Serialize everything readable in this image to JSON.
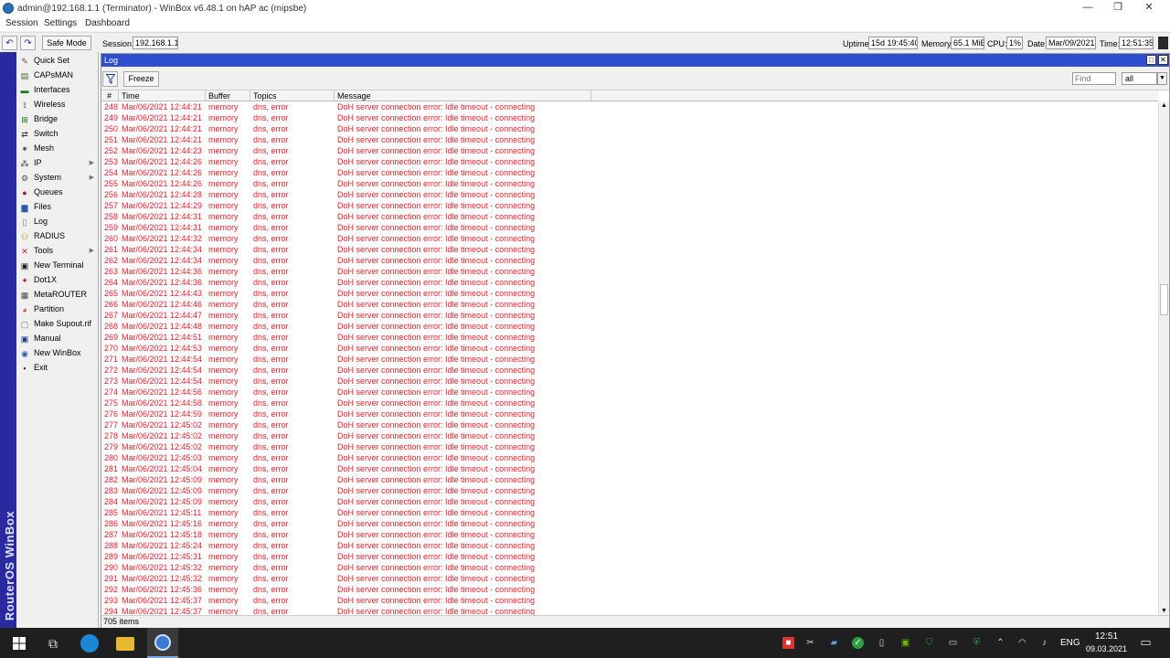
{
  "window": {
    "title": "admin@192.168.1.1 (Terminator) - WinBox v6.48.1 on hAP ac (mipsbe)",
    "minimize": "—",
    "maximize": "❐",
    "close": "✕"
  },
  "menu": {
    "session": "Session",
    "settings": "Settings",
    "dashboard": "Dashboard"
  },
  "toolbar": {
    "undo_icon": "undo-icon",
    "redo_icon": "redo-icon",
    "safe_mode": "Safe Mode",
    "session_label": "Session:",
    "session_value": "192.168.1.1",
    "uptime_label": "Uptime:",
    "uptime_value": "15d 19:45:40",
    "memory_label": "Memory:",
    "memory_value": "65.1 MiB",
    "cpu_label": "CPU:",
    "cpu_value": "1%",
    "date_label": "Date:",
    "date_value": "Mar/09/2021",
    "time_label": "Time:",
    "time_value": "12:51:35"
  },
  "brand_vertical": "RouterOS WinBox",
  "sidebar": {
    "items": [
      {
        "label": "Quick Set",
        "icon": "quick-set-icon",
        "glyph": "✎",
        "color": "#7a4a2a",
        "arrow": false
      },
      {
        "label": "CAPsMAN",
        "icon": "capsman-icon",
        "glyph": "▤",
        "color": "#3a6a3a",
        "arrow": false
      },
      {
        "label": "Interfaces",
        "icon": "interfaces-icon",
        "glyph": "▬",
        "color": "#1a7a1a",
        "arrow": false
      },
      {
        "label": "Wireless",
        "icon": "wireless-icon",
        "glyph": "⟟",
        "color": "#222",
        "arrow": false
      },
      {
        "label": "Bridge",
        "icon": "bridge-icon",
        "glyph": "⊞",
        "color": "#1a6a1a",
        "arrow": false
      },
      {
        "label": "Switch",
        "icon": "switch-icon",
        "glyph": "⇄",
        "color": "#333",
        "arrow": false
      },
      {
        "label": "Mesh",
        "icon": "mesh-icon",
        "glyph": "✶",
        "color": "#333",
        "arrow": false
      },
      {
        "label": "IP",
        "icon": "ip-icon",
        "glyph": "⁂",
        "color": "#444",
        "arrow": true
      },
      {
        "label": "System",
        "icon": "system-icon",
        "glyph": "⚙",
        "color": "#555",
        "arrow": true
      },
      {
        "label": "Queues",
        "icon": "queues-icon",
        "glyph": "●",
        "color": "#8a2a2a",
        "arrow": false
      },
      {
        "label": "Files",
        "icon": "files-icon",
        "glyph": "▆",
        "color": "#2a5aa8",
        "arrow": false
      },
      {
        "label": "Log",
        "icon": "log-icon",
        "glyph": "▯",
        "color": "#777",
        "arrow": false
      },
      {
        "label": "RADIUS",
        "icon": "radius-icon",
        "glyph": "⚇",
        "color": "#b58a00",
        "arrow": false
      },
      {
        "label": "Tools",
        "icon": "tools-icon",
        "glyph": "✕",
        "color": "#b02a2a",
        "arrow": true
      },
      {
        "label": "New Terminal",
        "icon": "terminal-icon",
        "glyph": "▣",
        "color": "#222",
        "arrow": false
      },
      {
        "label": "Dot1X",
        "icon": "dot1x-icon",
        "glyph": "✦",
        "color": "#b02a2a",
        "arrow": false
      },
      {
        "label": "MetaROUTER",
        "icon": "metarouter-icon",
        "glyph": "▦",
        "color": "#444",
        "arrow": false
      },
      {
        "label": "Partition",
        "icon": "partition-icon",
        "glyph": "◕",
        "color": "#c04a1a",
        "arrow": false
      },
      {
        "label": "Make Supout.rif",
        "icon": "supout-icon",
        "glyph": "▢",
        "color": "#777",
        "arrow": false
      },
      {
        "label": "Manual",
        "icon": "manual-icon",
        "glyph": "▣",
        "color": "#1a3a8a",
        "arrow": false
      },
      {
        "label": "New WinBox",
        "icon": "winbox-icon",
        "glyph": "◉",
        "color": "#2a5aa8",
        "arrow": false
      },
      {
        "label": "Exit",
        "icon": "exit-icon",
        "glyph": "▪",
        "color": "#6a2a1a",
        "arrow": false
      }
    ]
  },
  "log": {
    "title": "Log",
    "restore_icon": "□",
    "close_icon": "✕",
    "freeze": "Freeze",
    "find_placeholder": "Find",
    "filter_value": "all",
    "columns": [
      "#",
      "Time",
      "Buffer",
      "Topics",
      "Message"
    ],
    "rows": [
      [
        "248",
        "Mar/06/2021 12:44:21",
        "memory",
        "dns, error",
        "DoH server connection error: Idle timeout - connecting"
      ],
      [
        "249",
        "Mar/06/2021 12:44:21",
        "memory",
        "dns, error",
        "DoH server connection error: Idle timeout - connecting"
      ],
      [
        "250",
        "Mar/06/2021 12:44:21",
        "memory",
        "dns, error",
        "DoH server connection error: Idle timeout - connecting"
      ],
      [
        "251",
        "Mar/06/2021 12:44:21",
        "memory",
        "dns, error",
        "DoH server connection error: Idle timeout - connecting"
      ],
      [
        "252",
        "Mar/06/2021 12:44:23",
        "memory",
        "dns, error",
        "DoH server connection error: Idle timeout - connecting"
      ],
      [
        "253",
        "Mar/06/2021 12:44:26",
        "memory",
        "dns, error",
        "DoH server connection error: Idle timeout - connecting"
      ],
      [
        "254",
        "Mar/06/2021 12:44:26",
        "memory",
        "dns, error",
        "DoH server connection error: Idle timeout - connecting"
      ],
      [
        "255",
        "Mar/06/2021 12:44:26",
        "memory",
        "dns, error",
        "DoH server connection error: Idle timeout - connecting"
      ],
      [
        "256",
        "Mar/06/2021 12:44:28",
        "memory",
        "dns, error",
        "DoH server connection error: Idle timeout - connecting"
      ],
      [
        "257",
        "Mar/06/2021 12:44:29",
        "memory",
        "dns, error",
        "DoH server connection error: Idle timeout - connecting"
      ],
      [
        "258",
        "Mar/06/2021 12:44:31",
        "memory",
        "dns, error",
        "DoH server connection error: Idle timeout - connecting"
      ],
      [
        "259",
        "Mar/06/2021 12:44:31",
        "memory",
        "dns, error",
        "DoH server connection error: Idle timeout - connecting"
      ],
      [
        "260",
        "Mar/06/2021 12:44:32",
        "memory",
        "dns, error",
        "DoH server connection error: Idle timeout - connecting"
      ],
      [
        "261",
        "Mar/06/2021 12:44:34",
        "memory",
        "dns, error",
        "DoH server connection error: Idle timeout - connecting"
      ],
      [
        "262",
        "Mar/06/2021 12:44:34",
        "memory",
        "dns, error",
        "DoH server connection error: Idle timeout - connecting"
      ],
      [
        "263",
        "Mar/06/2021 12:44:36",
        "memory",
        "dns, error",
        "DoH server connection error: Idle timeout - connecting"
      ],
      [
        "264",
        "Mar/06/2021 12:44:36",
        "memory",
        "dns, error",
        "DoH server connection error: Idle timeout - connecting"
      ],
      [
        "265",
        "Mar/06/2021 12:44:43",
        "memory",
        "dns, error",
        "DoH server connection error: Idle timeout - connecting"
      ],
      [
        "266",
        "Mar/06/2021 12:44:46",
        "memory",
        "dns, error",
        "DoH server connection error: Idle timeout - connecting"
      ],
      [
        "267",
        "Mar/06/2021 12:44:47",
        "memory",
        "dns, error",
        "DoH server connection error: Idle timeout - connecting"
      ],
      [
        "268",
        "Mar/06/2021 12:44:48",
        "memory",
        "dns, error",
        "DoH server connection error: Idle timeout - connecting"
      ],
      [
        "269",
        "Mar/06/2021 12:44:51",
        "memory",
        "dns, error",
        "DoH server connection error: Idle timeout - connecting"
      ],
      [
        "270",
        "Mar/06/2021 12:44:53",
        "memory",
        "dns, error",
        "DoH server connection error: Idle timeout - connecting"
      ],
      [
        "271",
        "Mar/06/2021 12:44:54",
        "memory",
        "dns, error",
        "DoH server connection error: Idle timeout - connecting"
      ],
      [
        "272",
        "Mar/06/2021 12:44:54",
        "memory",
        "dns, error",
        "DoH server connection error: Idle timeout - connecting"
      ],
      [
        "273",
        "Mar/06/2021 12:44:54",
        "memory",
        "dns, error",
        "DoH server connection error: Idle timeout - connecting"
      ],
      [
        "274",
        "Mar/06/2021 12:44:56",
        "memory",
        "dns, error",
        "DoH server connection error: Idle timeout - connecting"
      ],
      [
        "275",
        "Mar/06/2021 12:44:58",
        "memory",
        "dns, error",
        "DoH server connection error: Idle timeout - connecting"
      ],
      [
        "276",
        "Mar/06/2021 12:44:59",
        "memory",
        "dns, error",
        "DoH server connection error: Idle timeout - connecting"
      ],
      [
        "277",
        "Mar/06/2021 12:45:02",
        "memory",
        "dns, error",
        "DoH server connection error: Idle timeout - connecting"
      ],
      [
        "278",
        "Mar/06/2021 12:45:02",
        "memory",
        "dns, error",
        "DoH server connection error: Idle timeout - connecting"
      ],
      [
        "279",
        "Mar/06/2021 12:45:02",
        "memory",
        "dns, error",
        "DoH server connection error: Idle timeout - connecting"
      ],
      [
        "280",
        "Mar/06/2021 12:45:03",
        "memory",
        "dns, error",
        "DoH server connection error: Idle timeout - connecting"
      ],
      [
        "281",
        "Mar/06/2021 12:45:04",
        "memory",
        "dns, error",
        "DoH server connection error: Idle timeout - connecting"
      ],
      [
        "282",
        "Mar/06/2021 12:45:09",
        "memory",
        "dns, error",
        "DoH server connection error: Idle timeout - connecting"
      ],
      [
        "283",
        "Mar/06/2021 12:45:09",
        "memory",
        "dns, error",
        "DoH server connection error: Idle timeout - connecting"
      ],
      [
        "284",
        "Mar/06/2021 12:45:09",
        "memory",
        "dns, error",
        "DoH server connection error: Idle timeout - connecting"
      ],
      [
        "285",
        "Mar/06/2021 12:45:11",
        "memory",
        "dns, error",
        "DoH server connection error: Idle timeout - connecting"
      ],
      [
        "286",
        "Mar/06/2021 12:45:16",
        "memory",
        "dns, error",
        "DoH server connection error: Idle timeout - connecting"
      ],
      [
        "287",
        "Mar/06/2021 12:45:18",
        "memory",
        "dns, error",
        "DoH server connection error: Idle timeout - connecting"
      ],
      [
        "288",
        "Mar/06/2021 12:45:24",
        "memory",
        "dns, error",
        "DoH server connection error: Idle timeout - connecting"
      ],
      [
        "289",
        "Mar/06/2021 12:45:31",
        "memory",
        "dns, error",
        "DoH server connection error: Idle timeout - connecting"
      ],
      [
        "290",
        "Mar/06/2021 12:45:32",
        "memory",
        "dns, error",
        "DoH server connection error: Idle timeout - connecting"
      ],
      [
        "291",
        "Mar/06/2021 12:45:32",
        "memory",
        "dns, error",
        "DoH server connection error: Idle timeout - connecting"
      ],
      [
        "292",
        "Mar/06/2021 12:45:36",
        "memory",
        "dns, error",
        "DoH server connection error: Idle timeout - connecting"
      ],
      [
        "293",
        "Mar/06/2021 12:45:37",
        "memory",
        "dns, error",
        "DoH server connection error: Idle timeout - connecting"
      ],
      [
        "294",
        "Mar/06/2021 12:45:37",
        "memory",
        "dns, error",
        "DoH server connection error: Idle timeout - connecting"
      ]
    ],
    "row_color": "#e8202a",
    "status": "705 items"
  },
  "taskbar": {
    "start_icon": "windows-start-icon",
    "task_view_icon": "task-view-icon",
    "edge_icon": "edge-icon",
    "explorer_icon": "file-explorer-icon",
    "winbox_icon": "winbox-taskbar-icon",
    "language": "ENG",
    "clock_time": "12:51",
    "clock_date": "09.03.2021"
  }
}
